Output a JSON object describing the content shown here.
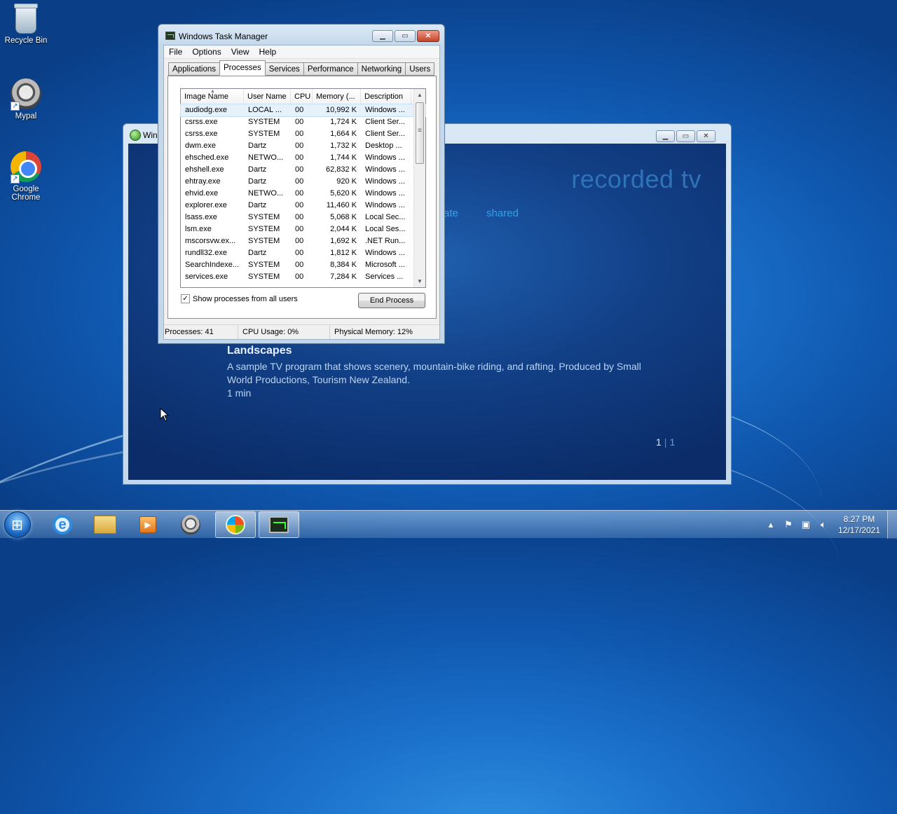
{
  "desktop": {
    "icons": [
      {
        "label": "Recycle Bin"
      },
      {
        "label": "Mypal"
      },
      {
        "label": "Google Chrome"
      }
    ]
  },
  "media_center": {
    "title": "Win",
    "heading": "recorded tv",
    "nav": [
      "ate",
      "shared"
    ],
    "program": {
      "title": "Landscapes",
      "description": "A sample TV program that shows scenery, mountain-bike riding, and rafting. Produced by Small World Productions, Tourism New Zealand.",
      "duration": "1 min"
    },
    "page_current": "1",
    "page_separator": "|",
    "page_total": "1"
  },
  "task_manager": {
    "title": "Windows Task Manager",
    "menu": [
      "File",
      "Options",
      "View",
      "Help"
    ],
    "tabs": [
      "Applications",
      "Processes",
      "Services",
      "Performance",
      "Networking",
      "Users"
    ],
    "active_tab": "Processes",
    "columns": [
      "Image Name",
      "User Name",
      "CPU",
      "Memory (...",
      "Description"
    ],
    "rows": [
      {
        "name": "audiodg.exe",
        "user": "LOCAL ...",
        "cpu": "00",
        "mem": "10,992 K",
        "desc": "Windows ..."
      },
      {
        "name": "csrss.exe",
        "user": "SYSTEM",
        "cpu": "00",
        "mem": "1,724 K",
        "desc": "Client Ser..."
      },
      {
        "name": "csrss.exe",
        "user": "SYSTEM",
        "cpu": "00",
        "mem": "1,664 K",
        "desc": "Client Ser..."
      },
      {
        "name": "dwm.exe",
        "user": "Dartz",
        "cpu": "00",
        "mem": "1,732 K",
        "desc": "Desktop ..."
      },
      {
        "name": "ehsched.exe",
        "user": "NETWO...",
        "cpu": "00",
        "mem": "1,744 K",
        "desc": "Windows ..."
      },
      {
        "name": "ehshell.exe",
        "user": "Dartz",
        "cpu": "00",
        "mem": "62,832 K",
        "desc": "Windows ..."
      },
      {
        "name": "ehtray.exe",
        "user": "Dartz",
        "cpu": "00",
        "mem": "920 K",
        "desc": "Windows ..."
      },
      {
        "name": "ehvid.exe",
        "user": "NETWO...",
        "cpu": "00",
        "mem": "5,620 K",
        "desc": "Windows ..."
      },
      {
        "name": "explorer.exe",
        "user": "Dartz",
        "cpu": "00",
        "mem": "11,460 K",
        "desc": "Windows ..."
      },
      {
        "name": "lsass.exe",
        "user": "SYSTEM",
        "cpu": "00",
        "mem": "5,068 K",
        "desc": "Local Sec..."
      },
      {
        "name": "lsm.exe",
        "user": "SYSTEM",
        "cpu": "00",
        "mem": "2,044 K",
        "desc": "Local Ses..."
      },
      {
        "name": "mscorsvw.ex...",
        "user": "SYSTEM",
        "cpu": "00",
        "mem": "1,692 K",
        "desc": ".NET Run..."
      },
      {
        "name": "rundll32.exe",
        "user": "Dartz",
        "cpu": "00",
        "mem": "1,812 K",
        "desc": "Windows ..."
      },
      {
        "name": "SearchIndexe...",
        "user": "SYSTEM",
        "cpu": "00",
        "mem": "8,384 K",
        "desc": "Microsoft ..."
      },
      {
        "name": "services.exe",
        "user": "SYSTEM",
        "cpu": "00",
        "mem": "7,284 K",
        "desc": "Services ..."
      }
    ],
    "show_all_label": "Show processes from all users",
    "show_all_checked": true,
    "end_process_label": "End Process",
    "status": {
      "processes": "Processes: 41",
      "cpu": "CPU Usage: 0%",
      "memory": "Physical Memory: 12%"
    }
  },
  "taskbar": {
    "items": [
      "internet-explorer",
      "windows-explorer",
      "media-player",
      "mypal",
      "windows-media-center",
      "task-manager"
    ],
    "active_item": "windows-media-center",
    "clock_time": "8:27 PM",
    "clock_date": "12/17/2021"
  },
  "icons": {
    "minimize": "minimize-icon",
    "maximize": "maximize-icon",
    "close": "close-icon"
  },
  "colors": {
    "desktop_blue": "#1a6fc9",
    "media_center_bg": "#123f86",
    "media_center_heading": "#2f72b8",
    "media_center_nav": "#36a0e6",
    "selected_row": "#e5f1fb",
    "close_button": "#c3442a"
  }
}
